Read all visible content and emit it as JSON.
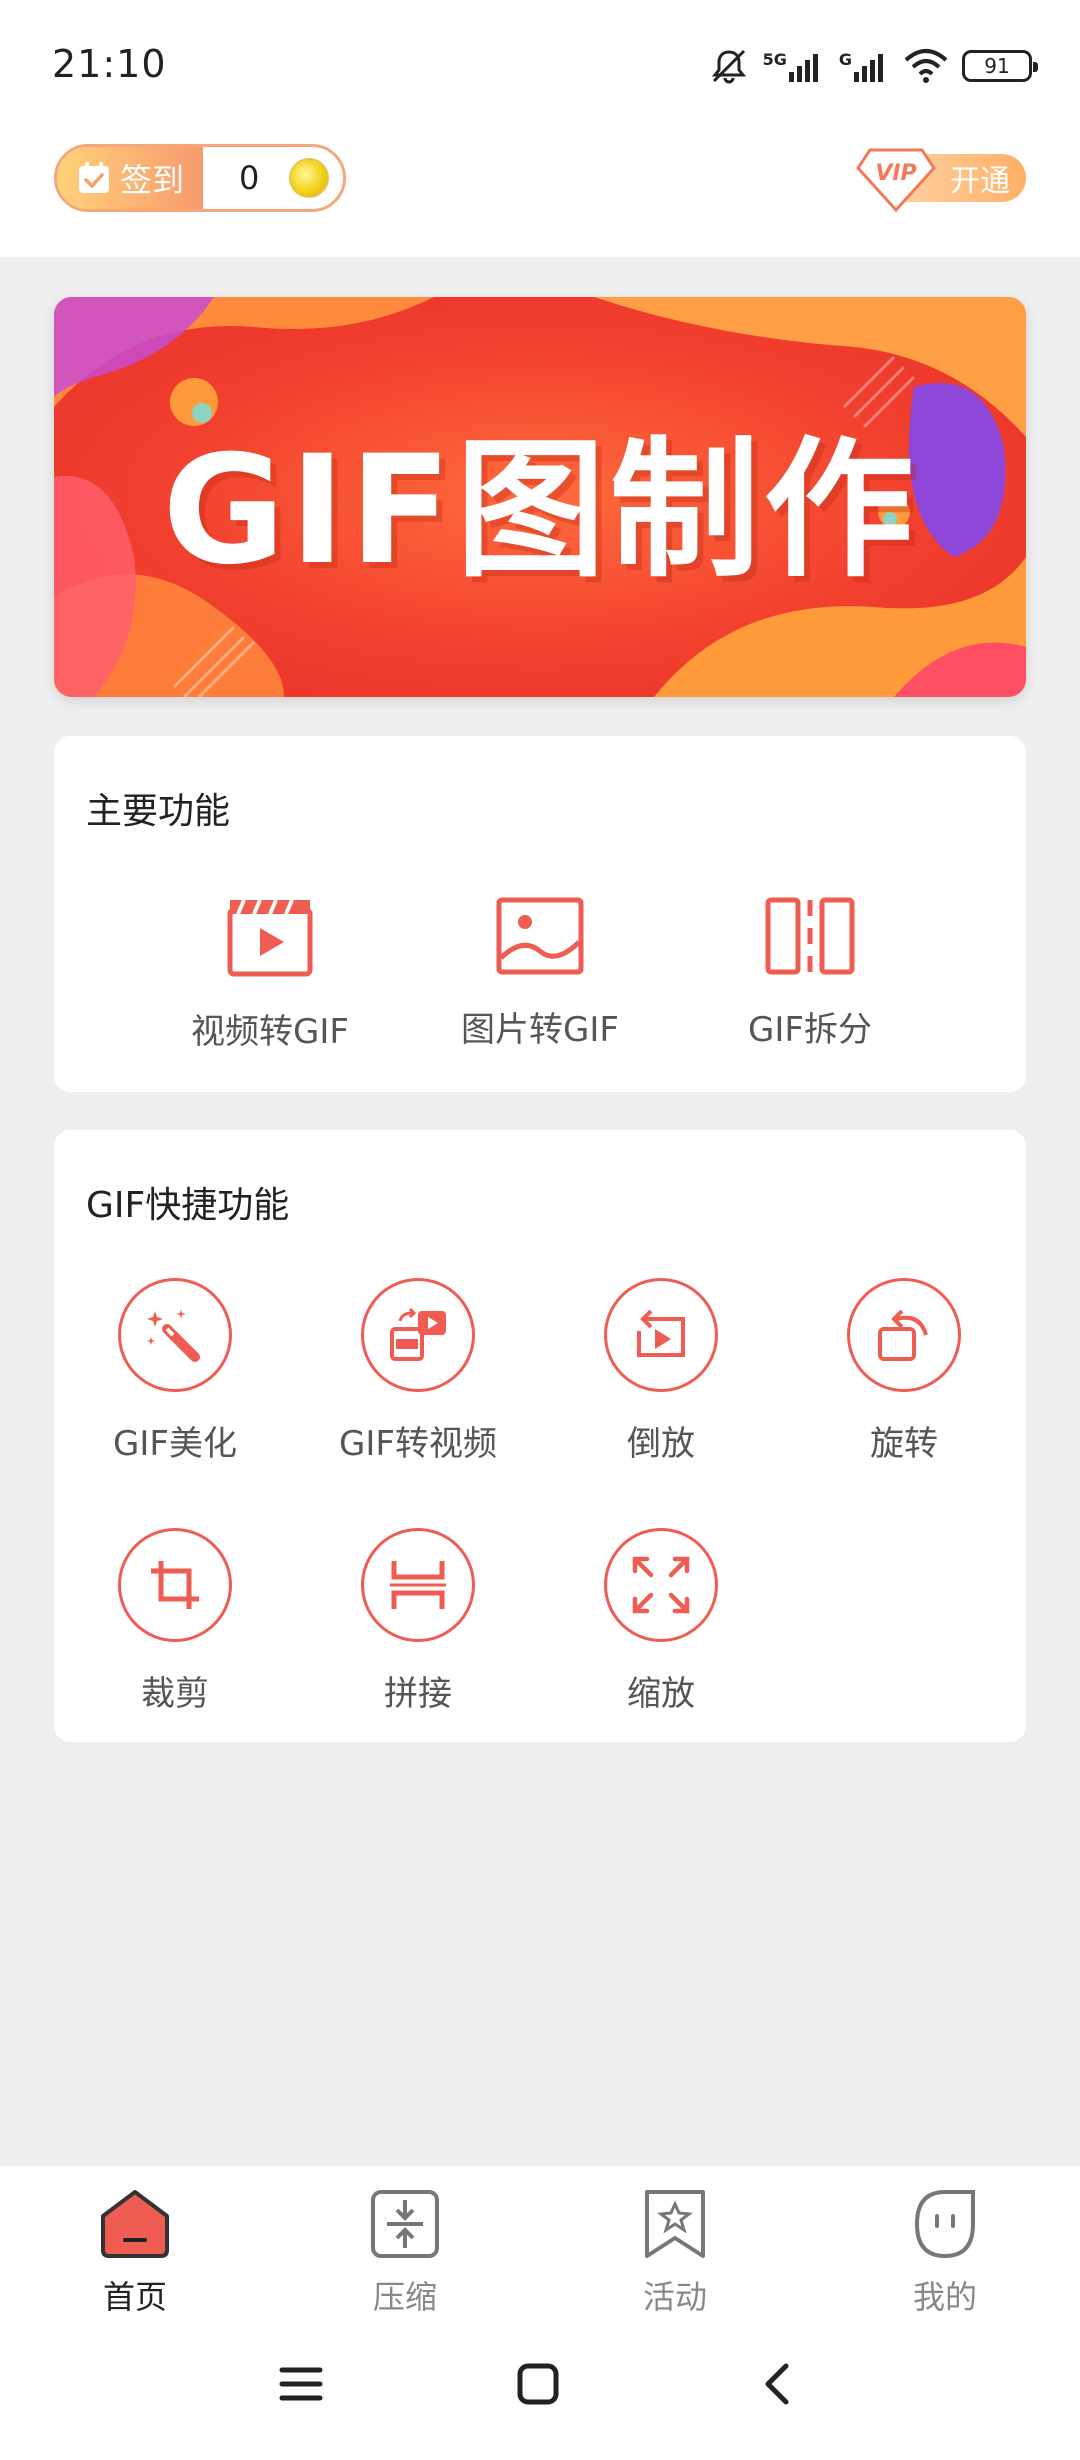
{
  "status_bar": {
    "time": "21:10",
    "network_1": "5G",
    "network_2": "G",
    "battery": "91",
    "icons": [
      "bell-muted-icon",
      "signal-icon",
      "signal-icon",
      "wifi-icon",
      "battery-icon"
    ]
  },
  "header": {
    "checkin_label": "签到",
    "coin_count": "0",
    "vip_badge": "VIP",
    "vip_label": "开通"
  },
  "banner": {
    "title": "GIF图制作"
  },
  "main_features": {
    "title": "主要功能",
    "items": [
      {
        "label": "视频转GIF",
        "icon": "video-clapper-icon"
      },
      {
        "label": "图片转GIF",
        "icon": "image-icon"
      },
      {
        "label": "GIF拆分",
        "icon": "split-icon"
      }
    ]
  },
  "quick_features": {
    "title": "GIF快捷功能",
    "items": [
      {
        "label": "GIF美化",
        "icon": "magic-wand-icon"
      },
      {
        "label": "GIF转视频",
        "icon": "gif-to-video-icon"
      },
      {
        "label": "倒放",
        "icon": "reverse-play-icon"
      },
      {
        "label": "旋转",
        "icon": "rotate-icon"
      },
      {
        "label": "裁剪",
        "icon": "crop-icon"
      },
      {
        "label": "拼接",
        "icon": "join-icon"
      },
      {
        "label": "缩放",
        "icon": "scale-icon"
      }
    ]
  },
  "bottom_nav": {
    "items": [
      {
        "label": "首页",
        "icon": "home-icon",
        "active": true
      },
      {
        "label": "压缩",
        "icon": "compress-icon",
        "active": false
      },
      {
        "label": "活动",
        "icon": "bookmark-star-icon",
        "active": false
      },
      {
        "label": "我的",
        "icon": "profile-face-icon",
        "active": false
      }
    ]
  },
  "colors": {
    "accent": "#ef5d52",
    "banner_red": "#f2402e",
    "banner_orange": "#ff8a3c",
    "vip_gold": "#ffb067"
  }
}
